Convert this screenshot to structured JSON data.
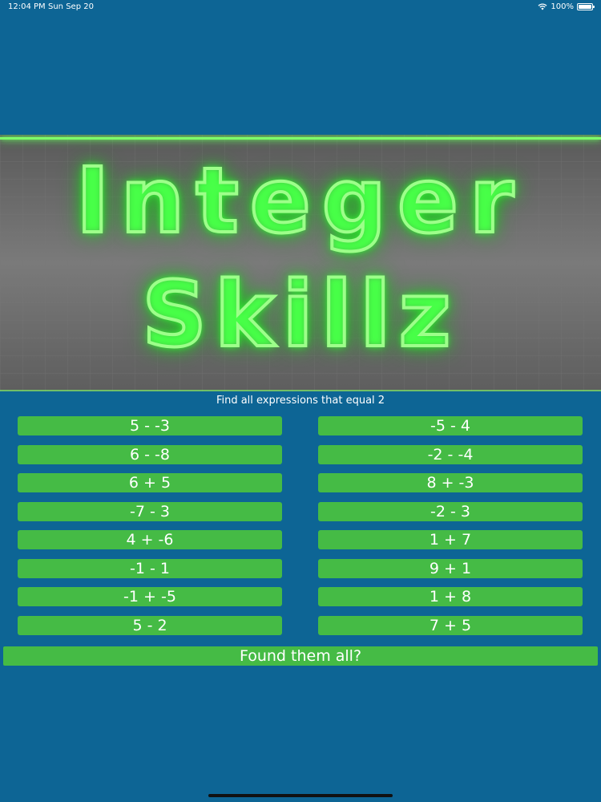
{
  "status_bar": {
    "time": "12:04 PM",
    "date": "Sun Sep 20",
    "battery": "100%"
  },
  "banner": {
    "title_line1": "Integer",
    "title_line2": "Skillz"
  },
  "instruction": "Find all expressions that equal 2",
  "answers": {
    "left": [
      "5 - -3",
      "6 - -8",
      "6 + 5",
      "-7 - 3",
      "4 + -6",
      "-1 - 1",
      "-1 + -5",
      "5 - 2"
    ],
    "right": [
      "-5 - 4",
      "-2 - -4",
      "8 + -3",
      "-2 - 3",
      "1 + 7",
      "9 + 1",
      "1 + 8",
      "7 + 5"
    ]
  },
  "found_button": "Found them all?",
  "colors": {
    "background": "#0d6595",
    "button": "#45bb45",
    "neon": "#7dff6a"
  }
}
